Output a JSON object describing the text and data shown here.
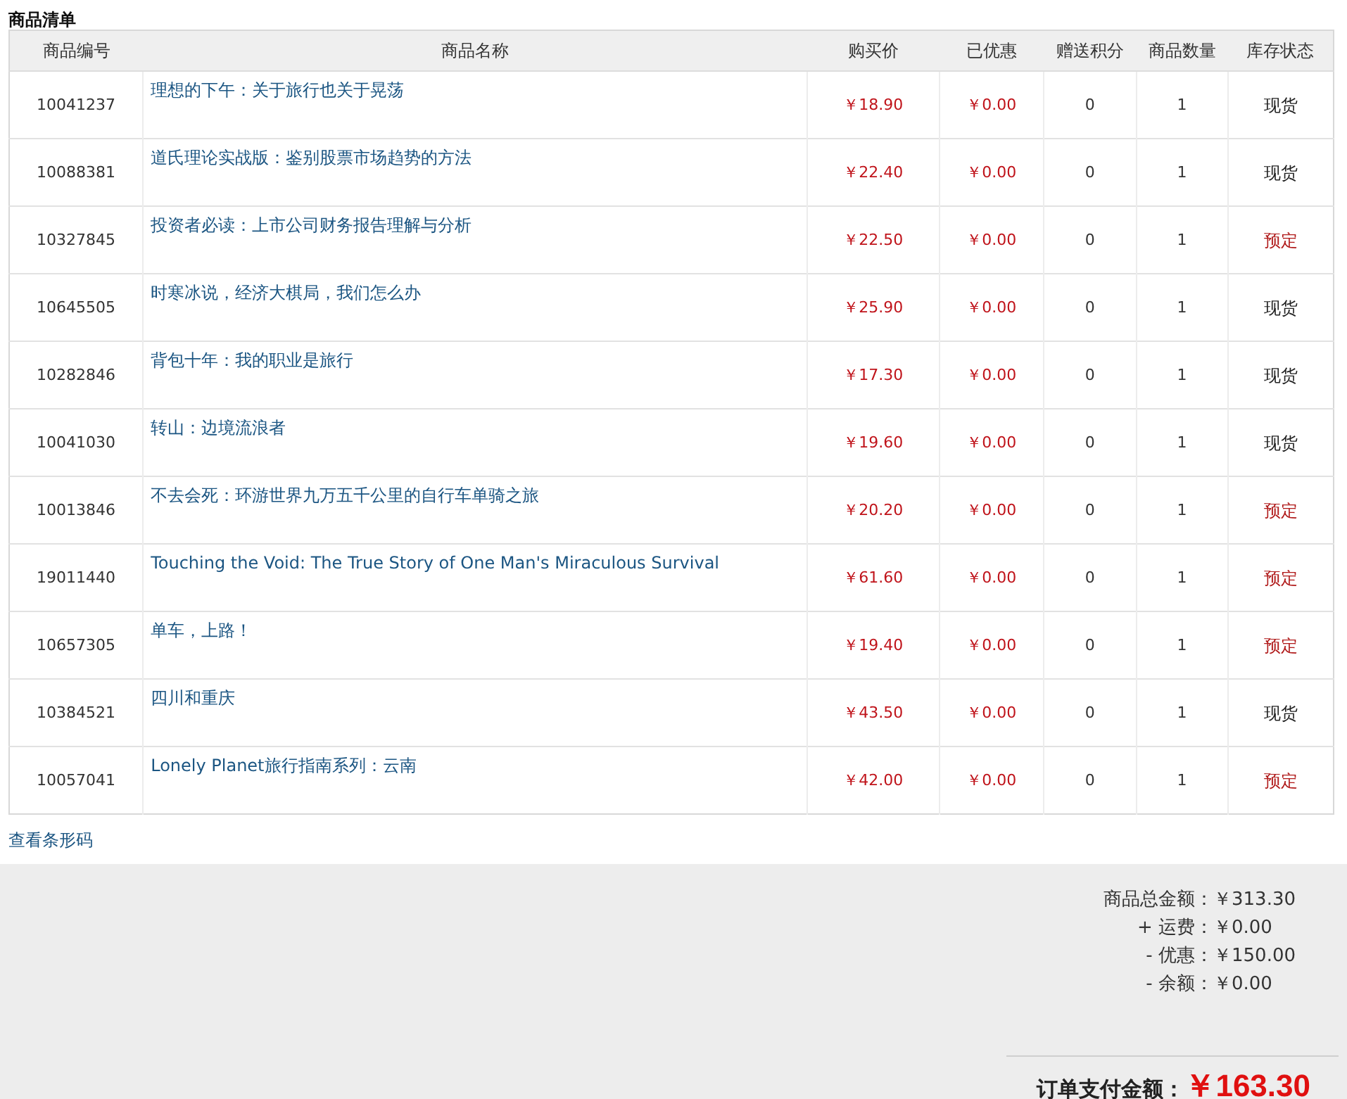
{
  "section_title": "商品清单",
  "table": {
    "columns": [
      "商品编号",
      "商品名称",
      "购买价",
      "已优惠",
      "赠送积分",
      "商品数量",
      "库存状态"
    ],
    "rows": [
      {
        "id": "10041237",
        "name": "理想的下午：关于旅行也关于晃荡",
        "price": "￥18.90",
        "discount": "￥0.00",
        "points": "0",
        "quantity": "1",
        "stock": "现货",
        "preorder": false
      },
      {
        "id": "10088381",
        "name": "道氏理论实战版：鉴别股票市场趋势的方法",
        "price": "￥22.40",
        "discount": "￥0.00",
        "points": "0",
        "quantity": "1",
        "stock": "现货",
        "preorder": false
      },
      {
        "id": "10327845",
        "name": "投资者必读：上市公司财务报告理解与分析",
        "price": "￥22.50",
        "discount": "￥0.00",
        "points": "0",
        "quantity": "1",
        "stock": "预定",
        "preorder": true
      },
      {
        "id": "10645505",
        "name": "时寒冰说，经济大棋局，我们怎么办",
        "price": "￥25.90",
        "discount": "￥0.00",
        "points": "0",
        "quantity": "1",
        "stock": "现货",
        "preorder": false
      },
      {
        "id": "10282846",
        "name": "背包十年：我的职业是旅行",
        "price": "￥17.30",
        "discount": "￥0.00",
        "points": "0",
        "quantity": "1",
        "stock": "现货",
        "preorder": false
      },
      {
        "id": "10041030",
        "name": "转山：边境流浪者",
        "price": "￥19.60",
        "discount": "￥0.00",
        "points": "0",
        "quantity": "1",
        "stock": "现货",
        "preorder": false
      },
      {
        "id": "10013846",
        "name": "不去会死：环游世界九万五千公里的自行车单骑之旅",
        "price": "￥20.20",
        "discount": "￥0.00",
        "points": "0",
        "quantity": "1",
        "stock": "预定",
        "preorder": true
      },
      {
        "id": "19011440",
        "name": "Touching the Void: The True Story of One Man's Miraculous Survival",
        "price": "￥61.60",
        "discount": "￥0.00",
        "points": "0",
        "quantity": "1",
        "stock": "预定",
        "preorder": true
      },
      {
        "id": "10657305",
        "name": "单车，上路！",
        "price": "￥19.40",
        "discount": "￥0.00",
        "points": "0",
        "quantity": "1",
        "stock": "预定",
        "preorder": true
      },
      {
        "id": "10384521",
        "name": "四川和重庆",
        "price": "￥43.50",
        "discount": "￥0.00",
        "points": "0",
        "quantity": "1",
        "stock": "现货",
        "preorder": false
      },
      {
        "id": "10057041",
        "name": "Lonely Planet旅行指南系列：云南",
        "price": "￥42.00",
        "discount": "￥0.00",
        "points": "0",
        "quantity": "1",
        "stock": "预定",
        "preorder": true
      }
    ]
  },
  "barcode_link": "查看条形码",
  "summary": [
    {
      "label": "商品总金额：",
      "value": "￥313.30"
    },
    {
      "label": "+ 运费：",
      "value": "￥0.00"
    },
    {
      "label": "- 优惠：",
      "value": "￥150.00"
    },
    {
      "label": "- 余额：",
      "value": "￥0.00"
    }
  ],
  "total": {
    "label": "订单支付金额：",
    "value": "￥163.30"
  }
}
